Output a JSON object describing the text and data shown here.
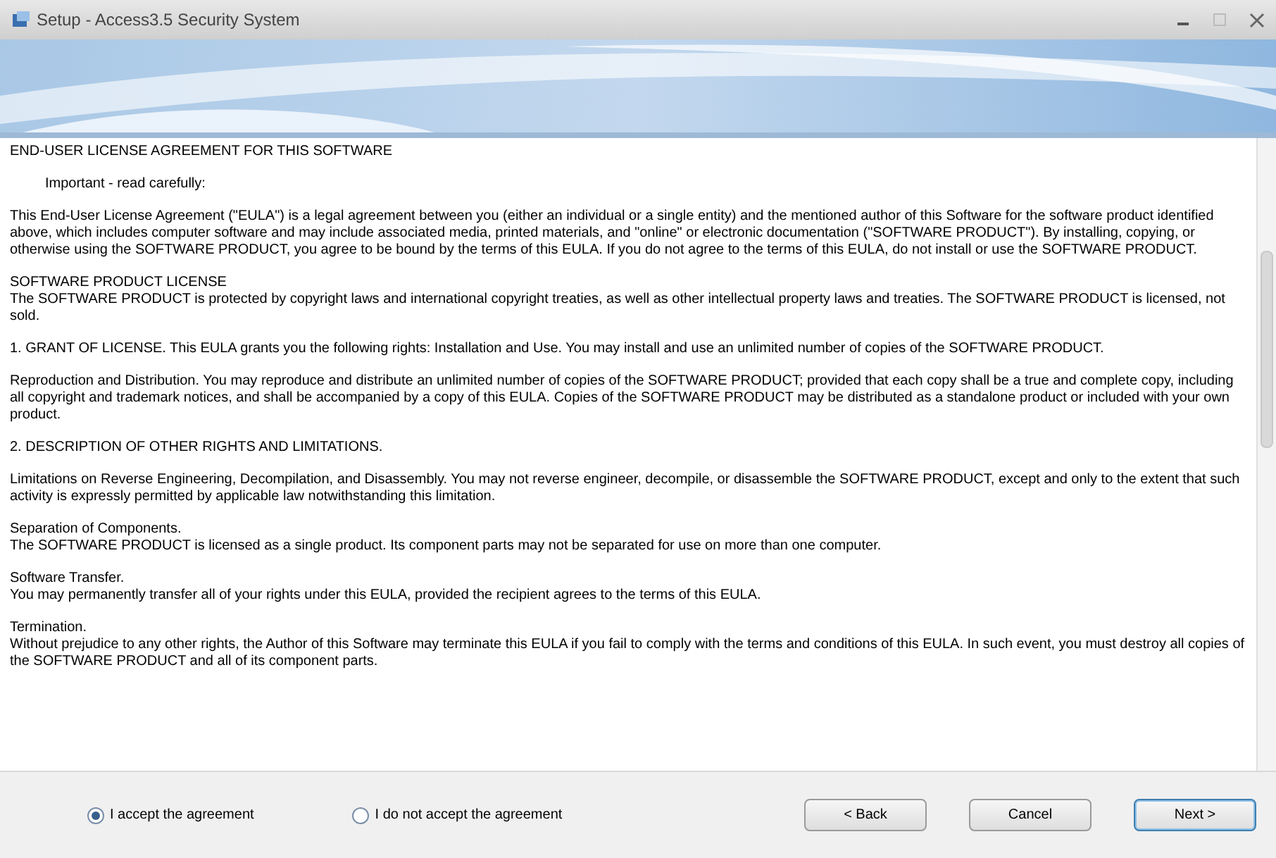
{
  "window": {
    "title": "Setup - Access3.5 Security System"
  },
  "license": {
    "paragraphs": [
      {
        "lines": [
          "END-USER LICENSE AGREEMENT FOR THIS SOFTWARE"
        ]
      },
      {
        "kind": "indent",
        "lines": [
          "Important - read carefully:"
        ]
      },
      {
        "lines": [
          "This End-User License Agreement (\"EULA\") is a legal agreement between you (either an individual or a single entity) and the mentioned author of this Software for the software product identified above, which includes computer software and may include associated media, printed materials, and \"online\" or electronic documentation (\"SOFTWARE PRODUCT\"). By installing, copying, or otherwise using the SOFTWARE PRODUCT, you agree to be bound by the terms of this EULA. If you do not agree to the terms of this EULA, do not install or use the SOFTWARE PRODUCT."
        ]
      },
      {
        "lines": [
          "SOFTWARE PRODUCT LICENSE",
          "The SOFTWARE PRODUCT is protected by copyright laws and international copyright treaties, as well as other intellectual property laws and treaties. The SOFTWARE PRODUCT is licensed, not sold."
        ]
      },
      {
        "lines": [
          "1. GRANT OF LICENSE. This EULA grants you the following rights: Installation and Use. You may install and use an unlimited number of copies of the SOFTWARE PRODUCT."
        ]
      },
      {
        "lines": [
          "Reproduction and Distribution. You may reproduce and distribute an unlimited number of copies of the SOFTWARE PRODUCT; provided that each copy shall be a true and complete copy, including all copyright and trademark notices, and shall be accompanied by a copy of this EULA. Copies of the SOFTWARE PRODUCT may be distributed as a standalone product or included with your own product."
        ]
      },
      {
        "lines": [
          "2. DESCRIPTION OF OTHER RIGHTS AND LIMITATIONS."
        ]
      },
      {
        "lines": [
          "Limitations on Reverse Engineering, Decompilation, and Disassembly. You may not reverse engineer, decompile, or disassemble the SOFTWARE PRODUCT, except and only to the extent that such activity is expressly permitted by applicable law notwithstanding this limitation."
        ]
      },
      {
        "lines": [
          "Separation of Components.",
          "The SOFTWARE PRODUCT is licensed as a single product. Its component parts may not be separated for use on more than one computer."
        ]
      },
      {
        "lines": [
          "Software Transfer.",
          "You may permanently transfer all of your rights under this EULA, provided the recipient agrees to the terms of this EULA."
        ]
      },
      {
        "lines": [
          "Termination.",
          "Without prejudice to any other rights, the Author of this Software may terminate this EULA if you fail to comply with the terms and conditions of this EULA. In such event, you must destroy all copies of the SOFTWARE PRODUCT and all of its component parts."
        ]
      }
    ]
  },
  "options": [
    {
      "label": "I accept the agreement",
      "selected": true
    },
    {
      "label": "I do not accept the agreement",
      "selected": false
    }
  ],
  "buttons": [
    {
      "label": "< Back",
      "default": false
    },
    {
      "label": "Cancel",
      "default": false
    },
    {
      "label": "Next >",
      "default": true
    }
  ]
}
